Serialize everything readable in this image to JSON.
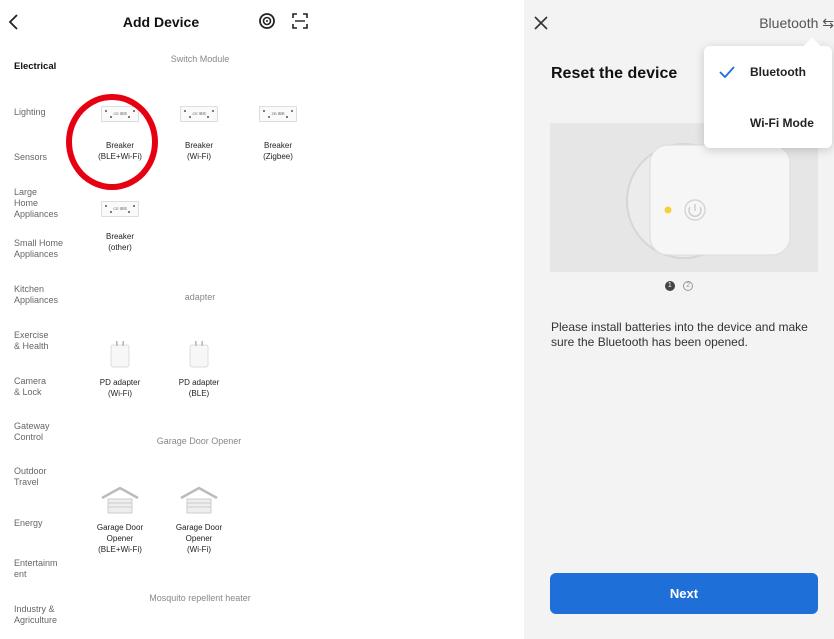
{
  "left": {
    "header": {
      "title": "Add Device"
    },
    "categories": [
      {
        "label": "Electrical",
        "active": true
      },
      {
        "label": "Lighting"
      },
      {
        "label": "Sensors"
      },
      {
        "label": "Large\nHome\nAppliances"
      },
      {
        "label": "Small Home\nAppliances"
      },
      {
        "label": "Kitchen\nAppliances"
      },
      {
        "label": "Exercise\n& Health"
      },
      {
        "label": "Camera\n& Lock"
      },
      {
        "label": "Gateway\nControl"
      },
      {
        "label": "Outdoor\nTravel"
      },
      {
        "label": "Energy"
      },
      {
        "label": "Entertainm\nent"
      },
      {
        "label": "Industry &\nAgriculture"
      }
    ],
    "sections": {
      "switch_module": "Switch Module",
      "adapter": "adapter",
      "garage": "Garage Door Opener",
      "mosquito": "Mosquito repellent heater"
    },
    "devices": {
      "breaker_ble_wifi": "Breaker\n(BLE+Wi-Fi)",
      "breaker_wifi": "Breaker\n(Wi-Fi)",
      "breaker_zigbee": "Breaker\n(Zigbee)",
      "breaker_other": "Breaker\n(other)",
      "pd_wifi": "PD adapter\n(Wi-Fi)",
      "pd_ble": "PD adapter\n(BLE)",
      "garage_ble_wifi": "Garage Door\nOpener\n(BLE+Wi-Fi)",
      "garage_wifi": "Garage Door\nOpener\n(Wi-Fi)"
    }
  },
  "right": {
    "mode_switch": "Bluetooth ⇆",
    "title": "Reset the device",
    "pager": [
      "1",
      "2"
    ],
    "instruction": "Please install batteries into the device and make sure the Bluetooth has been opened.",
    "next_label": "Next",
    "dropdown": [
      {
        "label": "Bluetooth",
        "selected": true
      },
      {
        "label": "Wi-Fi Mode",
        "selected": false
      }
    ]
  },
  "colors": {
    "accent": "#1f6fd8",
    "highlight": "#e60012",
    "indicator": "#f0d23a"
  }
}
